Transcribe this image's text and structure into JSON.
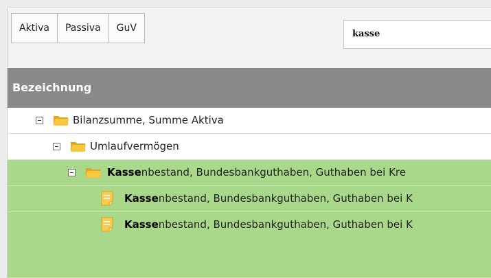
{
  "toolbar": {
    "tabs": [
      {
        "label": "Aktiva"
      },
      {
        "label": "Passiva"
      },
      {
        "label": "GuV"
      }
    ],
    "search_value": "kasse"
  },
  "grid": {
    "header": "Bezeichnung",
    "rows": [
      {
        "level": 1,
        "type": "folder",
        "expanded": true,
        "highlighted": false,
        "bold_part": "",
        "text": "Bilanzsumme, Summe Aktiva"
      },
      {
        "level": 2,
        "type": "folder",
        "expanded": true,
        "highlighted": false,
        "bold_part": "",
        "text": "Umlaufvermögen"
      },
      {
        "level": 3,
        "type": "folder",
        "expanded": true,
        "highlighted": true,
        "bold_part": "Kasse",
        "text": "nbestand, Bundesbankguthaben, Guthaben bei Kre"
      },
      {
        "level": 4,
        "type": "document",
        "highlighted": true,
        "bold_part": "Kasse",
        "text": "nbestand, Bundesbankguthaben, Guthaben bei K"
      },
      {
        "level": 4,
        "type": "document",
        "highlighted": true,
        "bold_part": "Kasse",
        "text": "nbestand, Bundesbankguthaben, Guthaben bei K"
      }
    ]
  },
  "colors": {
    "header_bg": "#8a8a8a",
    "highlight": "#a9d88a",
    "folder": "#f7c53a",
    "document": "#f6cd52"
  }
}
